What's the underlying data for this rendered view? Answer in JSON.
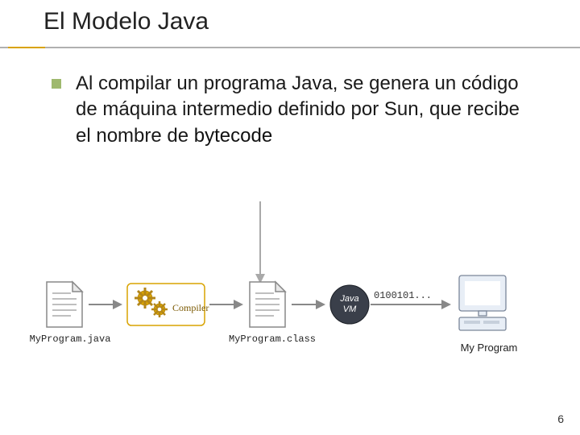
{
  "title": "El Modelo Java",
  "bullet_text": "Al compilar un programa Java, se genera un código de máquina intermedio definido por Sun, que recibe el nombre de ",
  "bullet_emph": "bytecode",
  "diagram": {
    "source_file": "MyProgram.java",
    "compiler_label": "Compiler",
    "class_file": "MyProgram.class",
    "vm_label_top": "Java",
    "vm_label_bot": "VM",
    "bitstream": "0100101...",
    "output_label": "My Program"
  },
  "page_number": "6"
}
